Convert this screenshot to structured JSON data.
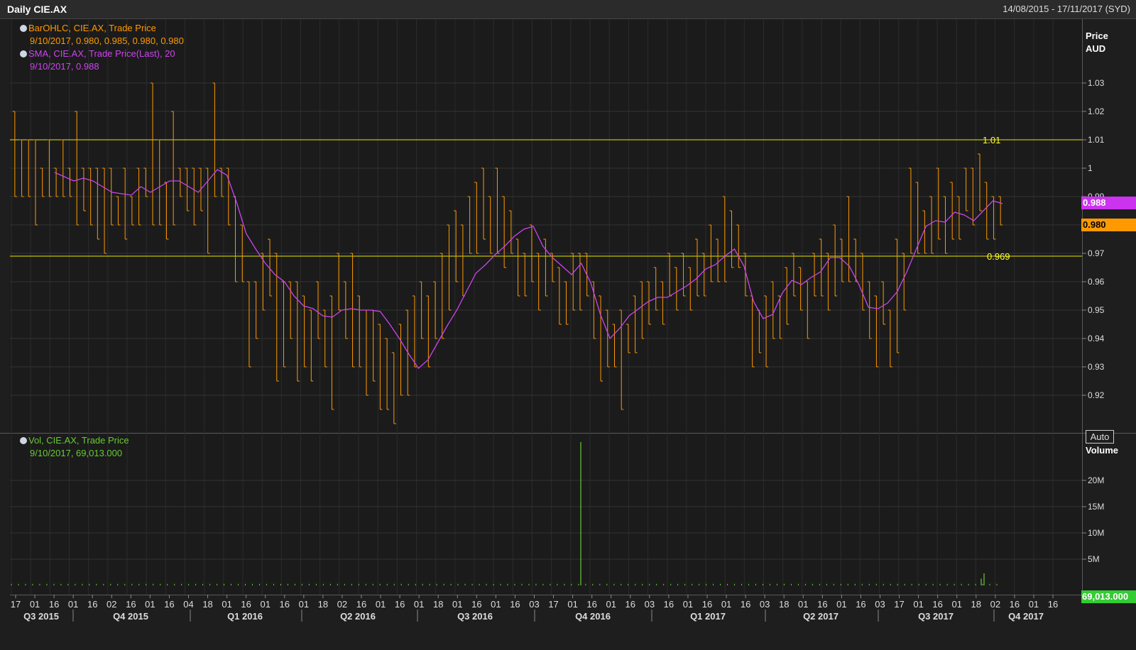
{
  "header": {
    "title": "Daily CIE.AX",
    "date_range": "14/08/2015 - 17/11/2017 (SYD)"
  },
  "price_panel": {
    "legend": [
      {
        "name": "BarOHLC, CIE.AX, Trade Price",
        "value": "9/10/2017, 0.980, 0.985, 0.980, 0.980",
        "color": "#ff9900"
      },
      {
        "name": "SMA, CIE.AX, Trade Price(Last),  20",
        "value": "9/10/2017, 0.988",
        "color": "#cc44ee"
      }
    ],
    "axis_title_line1": "Price",
    "axis_title_line2": "AUD",
    "auto_label": "Auto",
    "last_sma_tag": "0.988",
    "last_price_tag": "0.980",
    "hline_labels": [
      "1.01",
      "0.969"
    ]
  },
  "volume_panel": {
    "legend": {
      "name": "Vol, CIE.AX, Trade Price",
      "value": "9/10/2017, 69,013.000",
      "color": "#66cc33"
    },
    "axis_title": "Volume",
    "last_volume_tag": "69,013.000"
  },
  "chart_data": [
    {
      "type": "ohlc",
      "title": "Daily CIE.AX",
      "ylabel": "Price AUD",
      "ylim": [
        0.91,
        1.04
      ],
      "y_ticks": [
        "1.03",
        "1.02",
        "1.01",
        "1",
        "0.99",
        "0.98",
        "0.97",
        "0.96",
        "0.95",
        "0.94",
        "0.93",
        "0.92"
      ],
      "horizontal_lines": [
        {
          "label": "1.01",
          "value": 1.01,
          "color": "#e6e600"
        },
        {
          "label": "0.969",
          "value": 0.969,
          "color": "#e6e600"
        }
      ],
      "series": [
        {
          "name": "BarOHLC, CIE.AX, Trade Price",
          "color": "#ff9900",
          "bars": [
            [
              1.02,
              0.99
            ],
            [
              1.01,
              0.99
            ],
            [
              1.01,
              0.99
            ],
            [
              1.01,
              0.98
            ],
            [
              1.0,
              0.99
            ],
            [
              1.01,
              0.99
            ],
            [
              1.0,
              0.99
            ],
            [
              1.01,
              0.99
            ],
            [
              1.0,
              0.99
            ],
            [
              1.02,
              0.98
            ],
            [
              1.0,
              0.985
            ],
            [
              1.0,
              0.98
            ],
            [
              1.0,
              0.975
            ],
            [
              1.0,
              0.97
            ],
            [
              1.0,
              0.98
            ],
            [
              0.99,
              0.98
            ],
            [
              1.0,
              0.975
            ],
            [
              0.99,
              0.98
            ],
            [
              1.0,
              0.98
            ],
            [
              1.0,
              0.99
            ],
            [
              1.03,
              0.98
            ],
            [
              1.01,
              0.98
            ],
            [
              0.995,
              0.975
            ],
            [
              1.02,
              0.98
            ],
            [
              1.0,
              0.99
            ],
            [
              1.0,
              0.985
            ],
            [
              1.0,
              0.98
            ],
            [
              1.0,
              0.985
            ],
            [
              1.0,
              0.97
            ],
            [
              1.03,
              0.99
            ],
            [
              1.0,
              0.99
            ],
            [
              1.0,
              0.98
            ],
            [
              0.99,
              0.96
            ],
            [
              0.98,
              0.96
            ],
            [
              0.96,
              0.93
            ],
            [
              0.96,
              0.94
            ],
            [
              0.97,
              0.95
            ],
            [
              0.975,
              0.955
            ],
            [
              0.97,
              0.925
            ],
            [
              0.96,
              0.93
            ],
            [
              0.96,
              0.94
            ],
            [
              0.96,
              0.925
            ],
            [
              0.955,
              0.93
            ],
            [
              0.95,
              0.925
            ],
            [
              0.96,
              0.94
            ],
            [
              0.95,
              0.93
            ],
            [
              0.955,
              0.915
            ],
            [
              0.97,
              0.95
            ],
            [
              0.96,
              0.94
            ],
            [
              0.97,
              0.93
            ],
            [
              0.955,
              0.93
            ],
            [
              0.95,
              0.92
            ],
            [
              0.95,
              0.925
            ],
            [
              0.945,
              0.915
            ],
            [
              0.94,
              0.915
            ],
            [
              0.935,
              0.91
            ],
            [
              0.945,
              0.92
            ],
            [
              0.95,
              0.92
            ],
            [
              0.955,
              0.93
            ],
            [
              0.96,
              0.94
            ],
            [
              0.955,
              0.93
            ],
            [
              0.96,
              0.94
            ],
            [
              0.97,
              0.94
            ],
            [
              0.98,
              0.95
            ],
            [
              0.985,
              0.96
            ],
            [
              0.98,
              0.955
            ],
            [
              0.99,
              0.97
            ],
            [
              0.995,
              0.97
            ],
            [
              1.0,
              0.975
            ],
            [
              0.99,
              0.97
            ],
            [
              1.0,
              0.97
            ],
            [
              0.99,
              0.965
            ],
            [
              0.985,
              0.97
            ],
            [
              0.975,
              0.955
            ],
            [
              0.97,
              0.955
            ],
            [
              0.98,
              0.96
            ],
            [
              0.97,
              0.95
            ],
            [
              0.975,
              0.955
            ],
            [
              0.97,
              0.96
            ],
            [
              0.965,
              0.945
            ],
            [
              0.96,
              0.945
            ],
            [
              0.97,
              0.95
            ],
            [
              0.97,
              0.95
            ],
            [
              0.97,
              0.955
            ],
            [
              0.96,
              0.94
            ],
            [
              0.955,
              0.925
            ],
            [
              0.95,
              0.93
            ],
            [
              0.945,
              0.93
            ],
            [
              0.95,
              0.915
            ],
            [
              0.945,
              0.935
            ],
            [
              0.955,
              0.935
            ],
            [
              0.96,
              0.94
            ],
            [
              0.96,
              0.945
            ],
            [
              0.965,
              0.95
            ],
            [
              0.96,
              0.945
            ],
            [
              0.97,
              0.955
            ],
            [
              0.965,
              0.95
            ],
            [
              0.97,
              0.955
            ],
            [
              0.965,
              0.95
            ],
            [
              0.975,
              0.955
            ],
            [
              0.97,
              0.955
            ],
            [
              0.98,
              0.96
            ],
            [
              0.975,
              0.96
            ],
            [
              0.99,
              0.96
            ],
            [
              0.985,
              0.965
            ],
            [
              0.98,
              0.965
            ],
            [
              0.97,
              0.955
            ],
            [
              0.955,
              0.93
            ],
            [
              0.95,
              0.935
            ],
            [
              0.955,
              0.93
            ],
            [
              0.96,
              0.94
            ],
            [
              0.955,
              0.94
            ],
            [
              0.965,
              0.945
            ],
            [
              0.97,
              0.955
            ],
            [
              0.965,
              0.95
            ],
            [
              0.96,
              0.94
            ],
            [
              0.97,
              0.955
            ],
            [
              0.975,
              0.955
            ],
            [
              0.97,
              0.95
            ],
            [
              0.98,
              0.955
            ],
            [
              0.975,
              0.96
            ],
            [
              0.99,
              0.96
            ],
            [
              0.975,
              0.96
            ],
            [
              0.97,
              0.95
            ],
            [
              0.96,
              0.94
            ],
            [
              0.955,
              0.93
            ],
            [
              0.96,
              0.945
            ],
            [
              0.95,
              0.93
            ],
            [
              0.975,
              0.935
            ],
            [
              0.97,
              0.95
            ],
            [
              1.0,
              0.97
            ],
            [
              0.995,
              0.97
            ],
            [
              0.985,
              0.97
            ],
            [
              0.99,
              0.97
            ],
            [
              1.0,
              0.975
            ],
            [
              0.99,
              0.97
            ],
            [
              0.995,
              0.975
            ],
            [
              0.99,
              0.975
            ],
            [
              1.0,
              0.985
            ],
            [
              1.0,
              0.98
            ],
            [
              1.005,
              0.985
            ],
            [
              0.995,
              0.975
            ],
            [
              0.99,
              0.975
            ],
            [
              0.99,
              0.98
            ]
          ]
        }
      ]
    },
    {
      "type": "line",
      "ylabel": "Price AUD",
      "ylim": [
        0.91,
        1.04
      ],
      "series": [
        {
          "name": "SMA, CIE.AX, Trade Price(Last),  20",
          "color": "#cc44ee",
          "values": [
            0.9985,
            0.997,
            0.9955,
            0.9965,
            0.9955,
            0.9935,
            0.9915,
            0.991,
            0.9905,
            0.9935,
            0.9915,
            0.9935,
            0.9955,
            0.9955,
            0.9935,
            0.9915,
            0.9955,
            0.9995,
            0.9975,
            0.988,
            0.977,
            0.9715,
            0.9665,
            0.9625,
            0.96,
            0.955,
            0.9515,
            0.9505,
            0.948,
            0.9475,
            0.95,
            0.9505,
            0.95,
            0.95,
            0.9495,
            0.945,
            0.94,
            0.9345,
            0.9295,
            0.9325,
            0.9385,
            0.9445,
            0.95,
            0.9565,
            0.963,
            0.966,
            0.9695,
            0.9725,
            0.976,
            0.9785,
            0.9795,
            0.9725,
            0.9685,
            0.9655,
            0.9625,
            0.9665,
            0.9595,
            0.9485,
            0.94,
            0.9435,
            0.948,
            0.9505,
            0.953,
            0.9545,
            0.9545,
            0.9565,
            0.9585,
            0.961,
            0.9645,
            0.966,
            0.969,
            0.9715,
            0.9655,
            0.953,
            0.947,
            0.9485,
            0.956,
            0.9605,
            0.959,
            0.9615,
            0.9635,
            0.9685,
            0.9685,
            0.9655,
            0.959,
            0.951,
            0.9505,
            0.9525,
            0.9565,
            0.9635,
            0.9715,
            0.9795,
            0.9815,
            0.981,
            0.9845,
            0.9835,
            0.9815,
            0.985,
            0.9885,
            0.9875
          ]
        }
      ]
    },
    {
      "type": "bar",
      "title": "Vol, CIE.AX, Trade Price",
      "ylabel": "Volume",
      "ylim": [
        0,
        27500000
      ],
      "y_ticks": [
        "20M",
        "15M",
        "10M",
        "5M"
      ],
      "series": [
        {
          "name": "Vol, CIE.AX, Trade Price",
          "color": "#66cc33",
          "spikes": [
            {
              "label": "Q4 2016",
              "value": 27300000
            },
            {
              "label": "Q3 2017",
              "value": 2300000
            },
            {
              "label": "Q3 2017",
              "value": 1300000
            }
          ],
          "baseline_value": 300000
        }
      ]
    }
  ],
  "x_axis": {
    "day_labels": [
      "17",
      "01",
      "16",
      "01",
      "16",
      "02",
      "16",
      "01",
      "16",
      "04",
      "18",
      "01",
      "16",
      "01",
      "16",
      "01",
      "18",
      "02",
      "16",
      "01",
      "16",
      "01",
      "18",
      "01",
      "16",
      "01",
      "16",
      "03",
      "17",
      "01",
      "16",
      "01",
      "16",
      "03",
      "16",
      "01",
      "16",
      "01",
      "16",
      "03",
      "18",
      "01",
      "16",
      "01",
      "16",
      "03",
      "17",
      "01",
      "16",
      "01",
      "18",
      "02",
      "16",
      "01",
      "16"
    ],
    "quarter_labels": [
      "Q3 2015",
      "Q4 2015",
      "Q1 2016",
      "Q2 2016",
      "Q3 2016",
      "Q4 2016",
      "Q1 2017",
      "Q2 2017",
      "Q3 2017",
      "Q4 2017"
    ]
  }
}
